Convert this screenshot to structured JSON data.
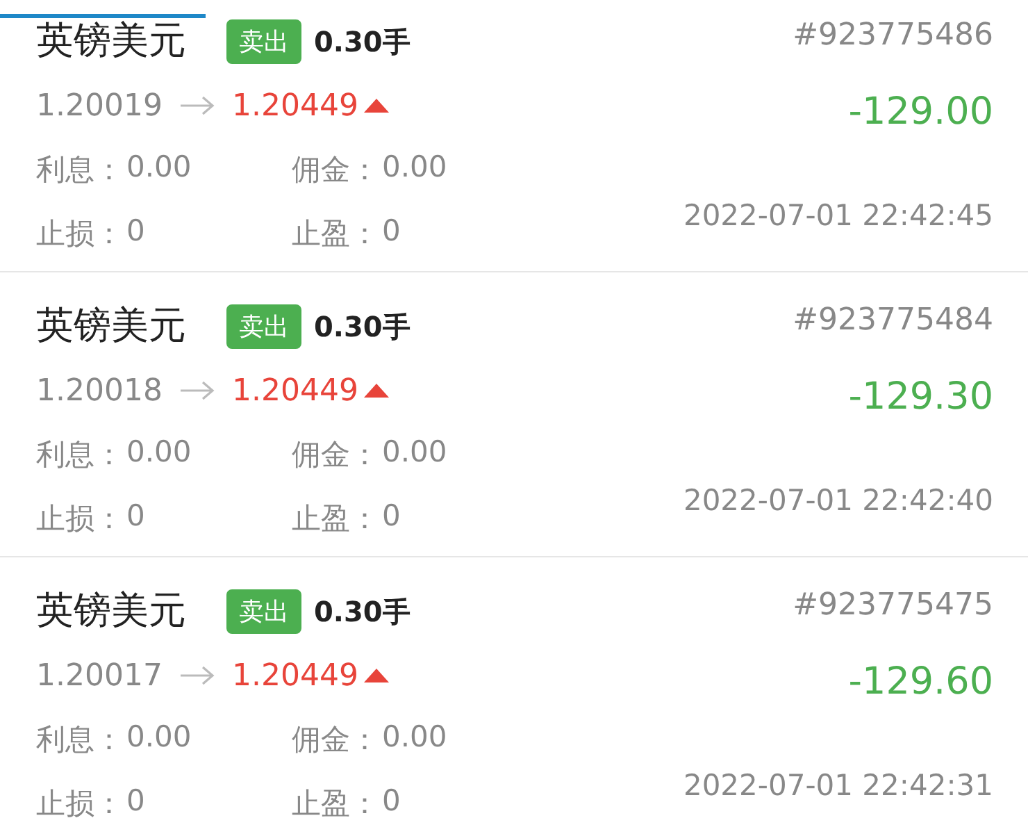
{
  "orders": [
    {
      "symbol": "英镑美元",
      "side": "卖出",
      "lots": "0.30手",
      "order_no": "#923775486",
      "open_price": "1.20019",
      "current_price": "1.20449",
      "rising": true,
      "profit": "-129.00",
      "swap_label": "利息：",
      "swap": "0.00",
      "commission_label": "佣金：",
      "commission": "0.00",
      "sl_label": "止损：",
      "sl": "0",
      "tp_label": "止盈：",
      "tp": "0",
      "time": "2022-07-01 22:42:45"
    },
    {
      "symbol": "英镑美元",
      "side": "卖出",
      "lots": "0.30手",
      "order_no": "#923775484",
      "open_price": "1.20018",
      "current_price": "1.20449",
      "rising": true,
      "profit": "-129.30",
      "swap_label": "利息：",
      "swap": "0.00",
      "commission_label": "佣金：",
      "commission": "0.00",
      "sl_label": "止损：",
      "sl": "0",
      "tp_label": "止盈：",
      "tp": "0",
      "time": "2022-07-01 22:42:40"
    },
    {
      "symbol": "英镑美元",
      "side": "卖出",
      "lots": "0.30手",
      "order_no": "#923775475",
      "open_price": "1.20017",
      "current_price": "1.20449",
      "rising": true,
      "profit": "-129.60",
      "swap_label": "利息：",
      "swap": "0.00",
      "commission_label": "佣金：",
      "commission": "0.00",
      "sl_label": "止损：",
      "sl": "0",
      "tp_label": "止盈：",
      "tp": "0",
      "time": "2022-07-01 22:42:31"
    }
  ]
}
